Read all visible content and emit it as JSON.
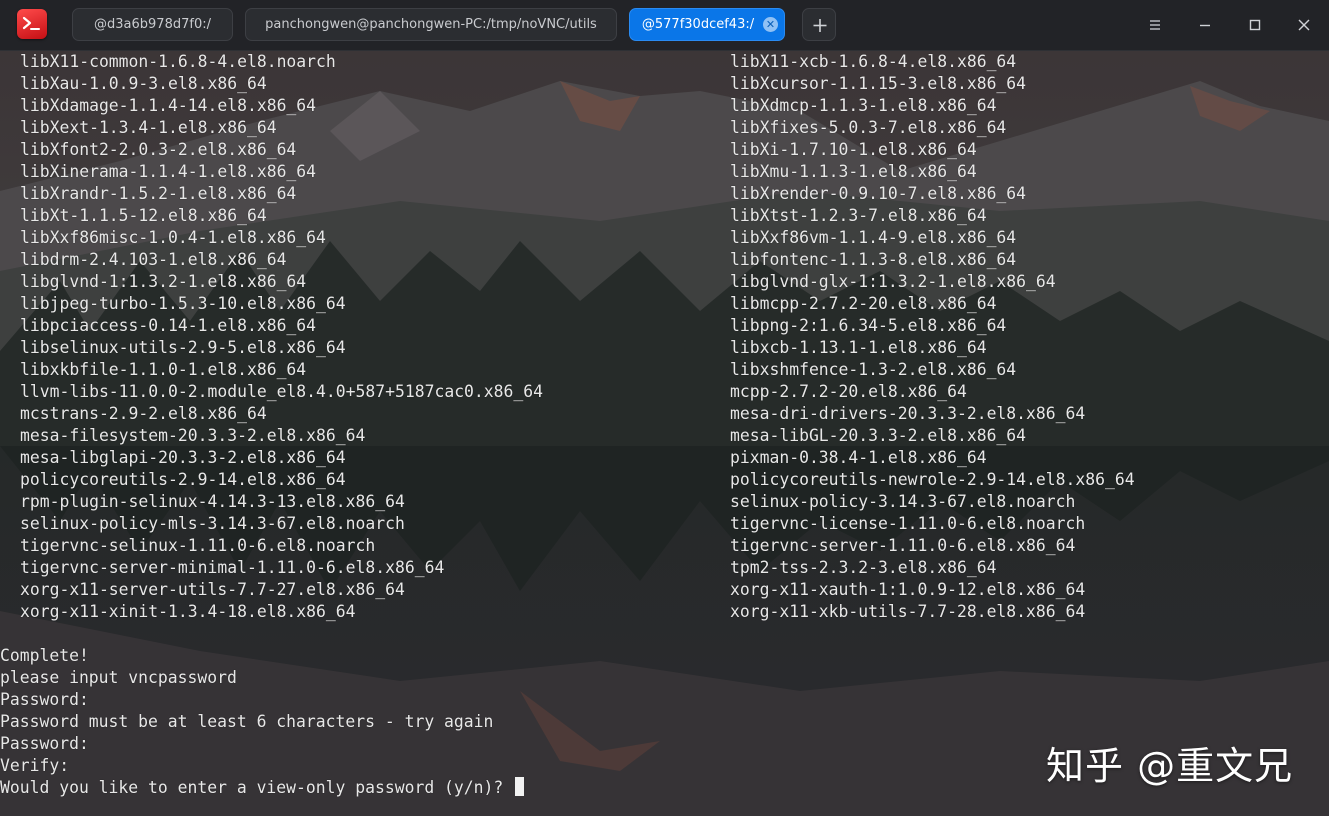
{
  "app": {
    "icon": "terminal-app-icon",
    "accent_color": "#0a76e8"
  },
  "tabs": [
    {
      "label": "@d3a6b978d7f0:/",
      "active": false
    },
    {
      "label": "panchongwen@panchongwen-PC:/tmp/noVNC/utils",
      "active": false
    },
    {
      "label": "@577f30dcef43:/",
      "active": true,
      "close_icon": "close-icon"
    }
  ],
  "toolbar": {
    "new_tab_icon": "plus-icon",
    "menu_icon": "hamburger-menu-icon",
    "minimize_icon": "minimize-icon",
    "maximize_icon": "maximize-icon",
    "close_icon": "close-icon"
  },
  "terminal": {
    "packages_left": [
      "libX11-common-1.6.8-4.el8.noarch",
      "libXau-1.0.9-3.el8.x86_64",
      "libXdamage-1.1.4-14.el8.x86_64",
      "libXext-1.3.4-1.el8.x86_64",
      "libXfont2-2.0.3-2.el8.x86_64",
      "libXinerama-1.1.4-1.el8.x86_64",
      "libXrandr-1.5.2-1.el8.x86_64",
      "libXt-1.1.5-12.el8.x86_64",
      "libXxf86misc-1.0.4-1.el8.x86_64",
      "libdrm-2.4.103-1.el8.x86_64",
      "libglvnd-1:1.3.2-1.el8.x86_64",
      "libjpeg-turbo-1.5.3-10.el8.x86_64",
      "libpciaccess-0.14-1.el8.x86_64",
      "libselinux-utils-2.9-5.el8.x86_64",
      "libxkbfile-1.1.0-1.el8.x86_64",
      "llvm-libs-11.0.0-2.module_el8.4.0+587+5187cac0.x86_64",
      "mcstrans-2.9-2.el8.x86_64",
      "mesa-filesystem-20.3.3-2.el8.x86_64",
      "mesa-libglapi-20.3.3-2.el8.x86_64",
      "policycoreutils-2.9-14.el8.x86_64",
      "rpm-plugin-selinux-4.14.3-13.el8.x86_64",
      "selinux-policy-mls-3.14.3-67.el8.noarch",
      "tigervnc-selinux-1.11.0-6.el8.noarch",
      "tigervnc-server-minimal-1.11.0-6.el8.x86_64",
      "xorg-x11-server-utils-7.7-27.el8.x86_64",
      "xorg-x11-xinit-1.3.4-18.el8.x86_64"
    ],
    "packages_right": [
      "libX11-xcb-1.6.8-4.el8.x86_64",
      "libXcursor-1.1.15-3.el8.x86_64",
      "libXdmcp-1.1.3-1.el8.x86_64",
      "libXfixes-5.0.3-7.el8.x86_64",
      "libXi-1.7.10-1.el8.x86_64",
      "libXmu-1.1.3-1.el8.x86_64",
      "libXrender-0.9.10-7.el8.x86_64",
      "libXtst-1.2.3-7.el8.x86_64",
      "libXxf86vm-1.1.4-9.el8.x86_64",
      "libfontenc-1.1.3-8.el8.x86_64",
      "libglvnd-glx-1:1.3.2-1.el8.x86_64",
      "libmcpp-2.7.2-20.el8.x86_64",
      "libpng-2:1.6.34-5.el8.x86_64",
      "libxcb-1.13.1-1.el8.x86_64",
      "libxshmfence-1.3-2.el8.x86_64",
      "mcpp-2.7.2-20.el8.x86_64",
      "mesa-dri-drivers-20.3.3-2.el8.x86_64",
      "mesa-libGL-20.3.3-2.el8.x86_64",
      "pixman-0.38.4-1.el8.x86_64",
      "policycoreutils-newrole-2.9-14.el8.x86_64",
      "selinux-policy-3.14.3-67.el8.noarch",
      "tigervnc-license-1.11.0-6.el8.noarch",
      "tigervnc-server-1.11.0-6.el8.x86_64",
      "tpm2-tss-2.3.2-3.el8.x86_64",
      "xorg-x11-xauth-1:1.0.9-12.el8.x86_64",
      "xorg-x11-xkb-utils-7.7-28.el8.x86_64"
    ],
    "output": [
      "Complete!",
      "please input vncpassword",
      "Password:",
      "Password must be at least 6 characters - try again",
      "Password:",
      "Verify:",
      "Would you like to enter a view-only password (y/n)? "
    ]
  },
  "watermark": "知乎 @重文兄"
}
